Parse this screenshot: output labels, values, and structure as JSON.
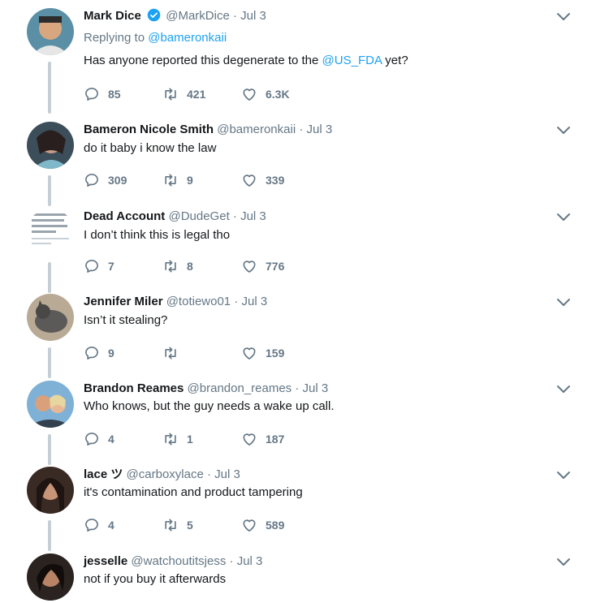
{
  "tweets": [
    {
      "name": "Mark Dice",
      "verified": true,
      "handle": "@MarkDice",
      "date": "Jul 3",
      "replying_label": "Replying to",
      "replying_to": "@bameronkaii",
      "text_before": "Has anyone reported this degenerate to the ",
      "mention": "@US_FDA",
      "text_after": " yet?",
      "replies": "85",
      "retweets": "421",
      "likes": "6.3K"
    },
    {
      "name": "Bameron Nicole Smith",
      "handle": "@bameronkaii",
      "date": "Jul 3",
      "text": "do it baby i know the law",
      "replies": "309",
      "retweets": "9",
      "likes": "339"
    },
    {
      "name": "Dead Account",
      "handle": "@DudeGet",
      "date": "Jul 3",
      "text": "I don’t think this is legal tho",
      "replies": "7",
      "retweets": "8",
      "likes": "776"
    },
    {
      "name": "Jennifer Miler",
      "handle": "@totiewo01",
      "date": "Jul 3",
      "text": "Isn’t it stealing?",
      "replies": "9",
      "retweets": "",
      "likes": "159"
    },
    {
      "name": "Brandon Reames",
      "handle": "@brandon_reames",
      "date": "Jul 3",
      "text": "Who knows, but the guy needs a wake up call.",
      "replies": "4",
      "retweets": "1",
      "likes": "187"
    },
    {
      "name": "lace ツ",
      "handle": "@carboxylace",
      "date": "Jul 3",
      "text": "it's contamination and product tampering",
      "replies": "4",
      "retweets": "5",
      "likes": "589"
    },
    {
      "name": "jesselle",
      "handle": "@watchoutitsjess",
      "date": "Jul 3",
      "text": "not if you buy it afterwards"
    }
  ],
  "separator": "·",
  "colors": {
    "accent": "#1da1f2",
    "muted": "#657786",
    "text": "#14171a",
    "thread": "#c4cfd6"
  },
  "icons": [
    "reply-icon",
    "retweet-icon",
    "like-icon",
    "caret-down-icon",
    "verified-badge-icon"
  ]
}
